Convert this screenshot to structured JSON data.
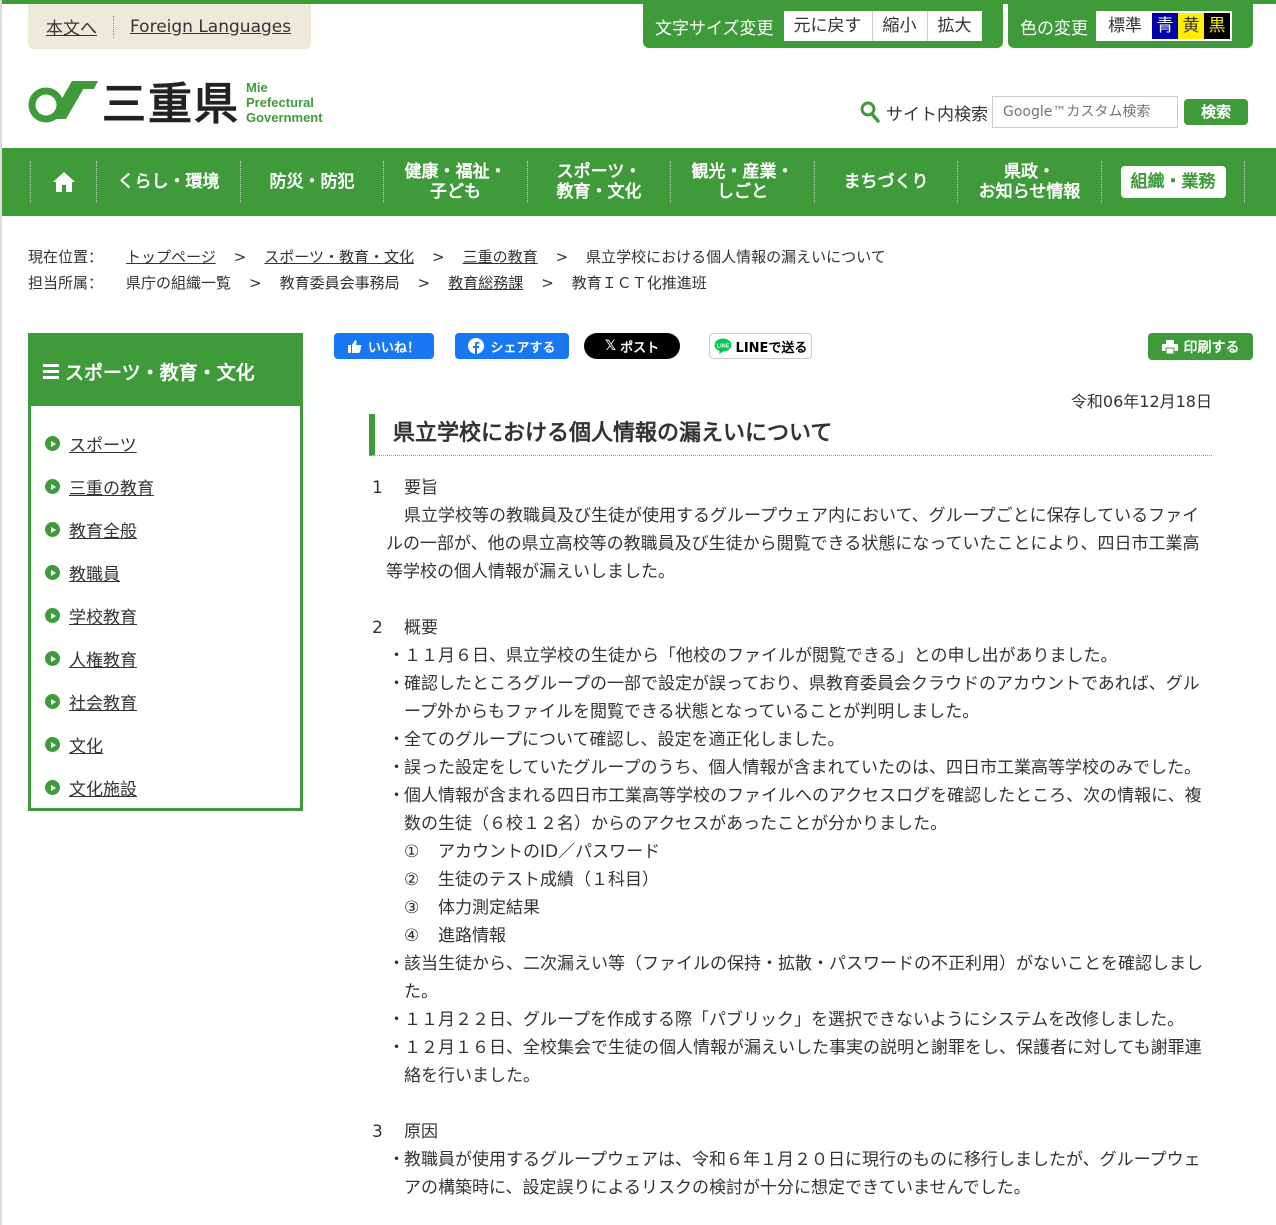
{
  "util": {
    "skip": "本文へ",
    "foreign": "Foreign Languages",
    "fontsize_label": "文字サイズ変更",
    "fontsize_buttons": [
      "元に戻す",
      "縮小",
      "拡大"
    ],
    "color_label": "色の変更",
    "color_buttons": [
      "標準",
      "青",
      "黄",
      "黒"
    ]
  },
  "logo": {
    "kanji": "三重県",
    "en1": "Mie",
    "en2": "Prefectural",
    "en3": "Government"
  },
  "search": {
    "label": "サイト内検索",
    "placeholder": "Google™カスタム検索",
    "button": "検索"
  },
  "nav": {
    "items": [
      "くらし・環境",
      "防災・防犯",
      "健康・福祉・\n子ども",
      "スポーツ・\n教育・文化",
      "観光・産業・\nしごと",
      "まちづくり",
      "県政・\nお知らせ情報"
    ],
    "org": "組織・業務"
  },
  "breadcrumb": {
    "current_label": "現在位置：",
    "current": [
      "トップページ",
      "スポーツ・教育・文化",
      "三重の教育"
    ],
    "current_last": "県立学校における個人情報の漏えいについて",
    "dept_label": "担当所属：",
    "dept_first": "県庁の組織一覧",
    "dept_second": "教育委員会事務局",
    "dept_link": "教育総務課",
    "dept_last": "教育ＩＣＴ化推進班",
    "separator": ">"
  },
  "sidebar": {
    "title": "スポーツ・教育・文化",
    "items": [
      "スポーツ",
      "三重の教育",
      "教育全般",
      "教職員",
      "学校教育",
      "人権教育",
      "社会教育",
      "文化",
      "文化施設"
    ]
  },
  "share": {
    "like": "いいね！",
    "fb": "シェアする",
    "x": "ポスト",
    "line": "LINEで送る",
    "print": "印刷する"
  },
  "article": {
    "date": "令和06年12月18日",
    "title": "県立学校における個人情報の漏えいについて",
    "s1_num": "1",
    "s1_head": "要旨",
    "s1_body": "県立学校等の教職員及び生徒が使用するグループウェア内において、グループごとに保存しているファイルの一部が、他の県立高校等の教職員及び生徒から閲覧できる状態になっていたことにより、四日市工業高等学校の個人情報が漏えいしました。",
    "s2_num": "2",
    "s2_head": "概要",
    "bullet": "・",
    "s2_b1": "１１月６日、県立学校の生徒から「他校のファイルが閲覧できる」との申し出がありました。",
    "s2_b2": "確認したところグループの一部で設定が誤っており、県教育委員会クラウドのアカウントであれば、グループ外からもファイルを閲覧できる状態となっていることが判明しました。",
    "s2_b3": "全てのグループについて確認し、設定を適正化しました。",
    "s2_b4": "誤った設定をしていたグループのうち、個人情報が含まれていたのは、四日市工業高等学校のみでした。",
    "s2_b5": "個人情報が含まれる四日市工業高等学校のファイルへのアクセスログを確認したところ、次の情報に、複数の生徒（６校１２名）からのアクセスがあったことが分かりました。",
    "s2_sub": [
      {
        "n": "①",
        "t": "アカウントのID／パスワード"
      },
      {
        "n": "②",
        "t": "生徒のテスト成績（１科目）"
      },
      {
        "n": "③",
        "t": "体力測定結果"
      },
      {
        "n": "④",
        "t": "進路情報"
      }
    ],
    "s2_b6": "該当生徒から、二次漏えい等（ファイルの保持・拡散・パスワードの不正利用）がないことを確認しました。",
    "s2_b7": "１１月２２日、グループを作成する際「パブリック」を選択できないようにシステムを改修しました。",
    "s2_b8": "１２月１６日、全校集会で生徒の個人情報が漏えいした事実の説明と謝罪をし、保護者に対しても謝罪連絡を行いました。",
    "s3_num": "3",
    "s3_head": "原因",
    "s3_b1": "教職員が使用するグループウェアは、令和６年１月２０日に現行のものに移行しましたが、グループウェアの構築時に、設定誤りによるリスクの検討が十分に想定できていませんでした。"
  },
  "colors": {
    "brand_green": "#3f9b3a",
    "facebook_blue": "#1877f2"
  }
}
